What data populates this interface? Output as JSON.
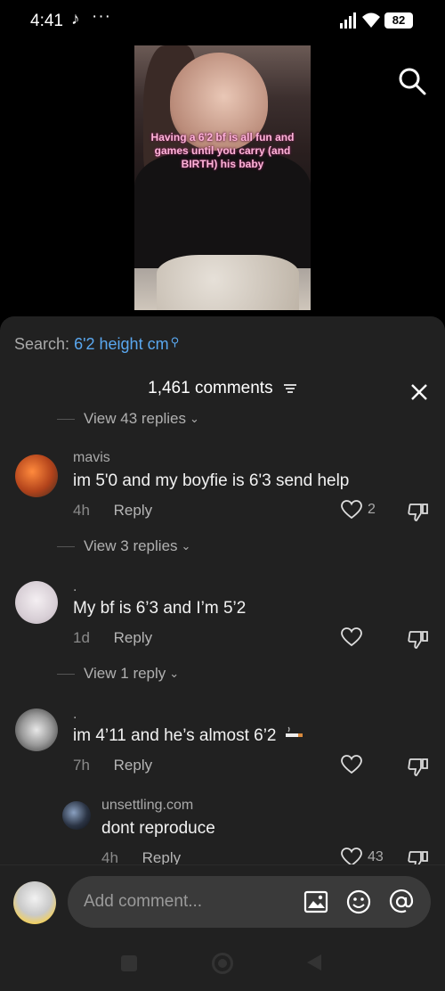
{
  "status_bar": {
    "time": "4:41",
    "battery": "82"
  },
  "video": {
    "caption": "Having a 6'2 bf is all fun and games until you carry (and BIRTH) his baby"
  },
  "search": {
    "label": "Search:",
    "query": "6'2 height cm"
  },
  "comments_header": {
    "count_label": "1,461 comments"
  },
  "top_view_replies": "View 43 replies",
  "comments": [
    {
      "username": "mavis",
      "text": "im 5'0 and my boyfie is 6'3 send help",
      "time": "4h",
      "reply_label": "Reply",
      "likes": "2",
      "view_replies": "View 3 replies"
    },
    {
      "username": ".",
      "text": "My bf is 6’3 and I’m 5’2",
      "time": "1d",
      "reply_label": "Reply",
      "likes": "",
      "view_replies": "View 1 reply"
    },
    {
      "username": ".",
      "text": "im 4’11 and he’s almost 6’2",
      "time": "7h",
      "reply_label": "Reply",
      "likes": ""
    }
  ],
  "reply": {
    "username": "unsettling.com",
    "text": "dont reproduce",
    "time": "4h",
    "reply_label": "Reply",
    "likes": "43"
  },
  "input": {
    "placeholder": "Add comment..."
  },
  "colors": {
    "sheet_bg": "#212121",
    "link_blue": "#5aa8f0",
    "caption_pink": "#ffb3d9"
  }
}
